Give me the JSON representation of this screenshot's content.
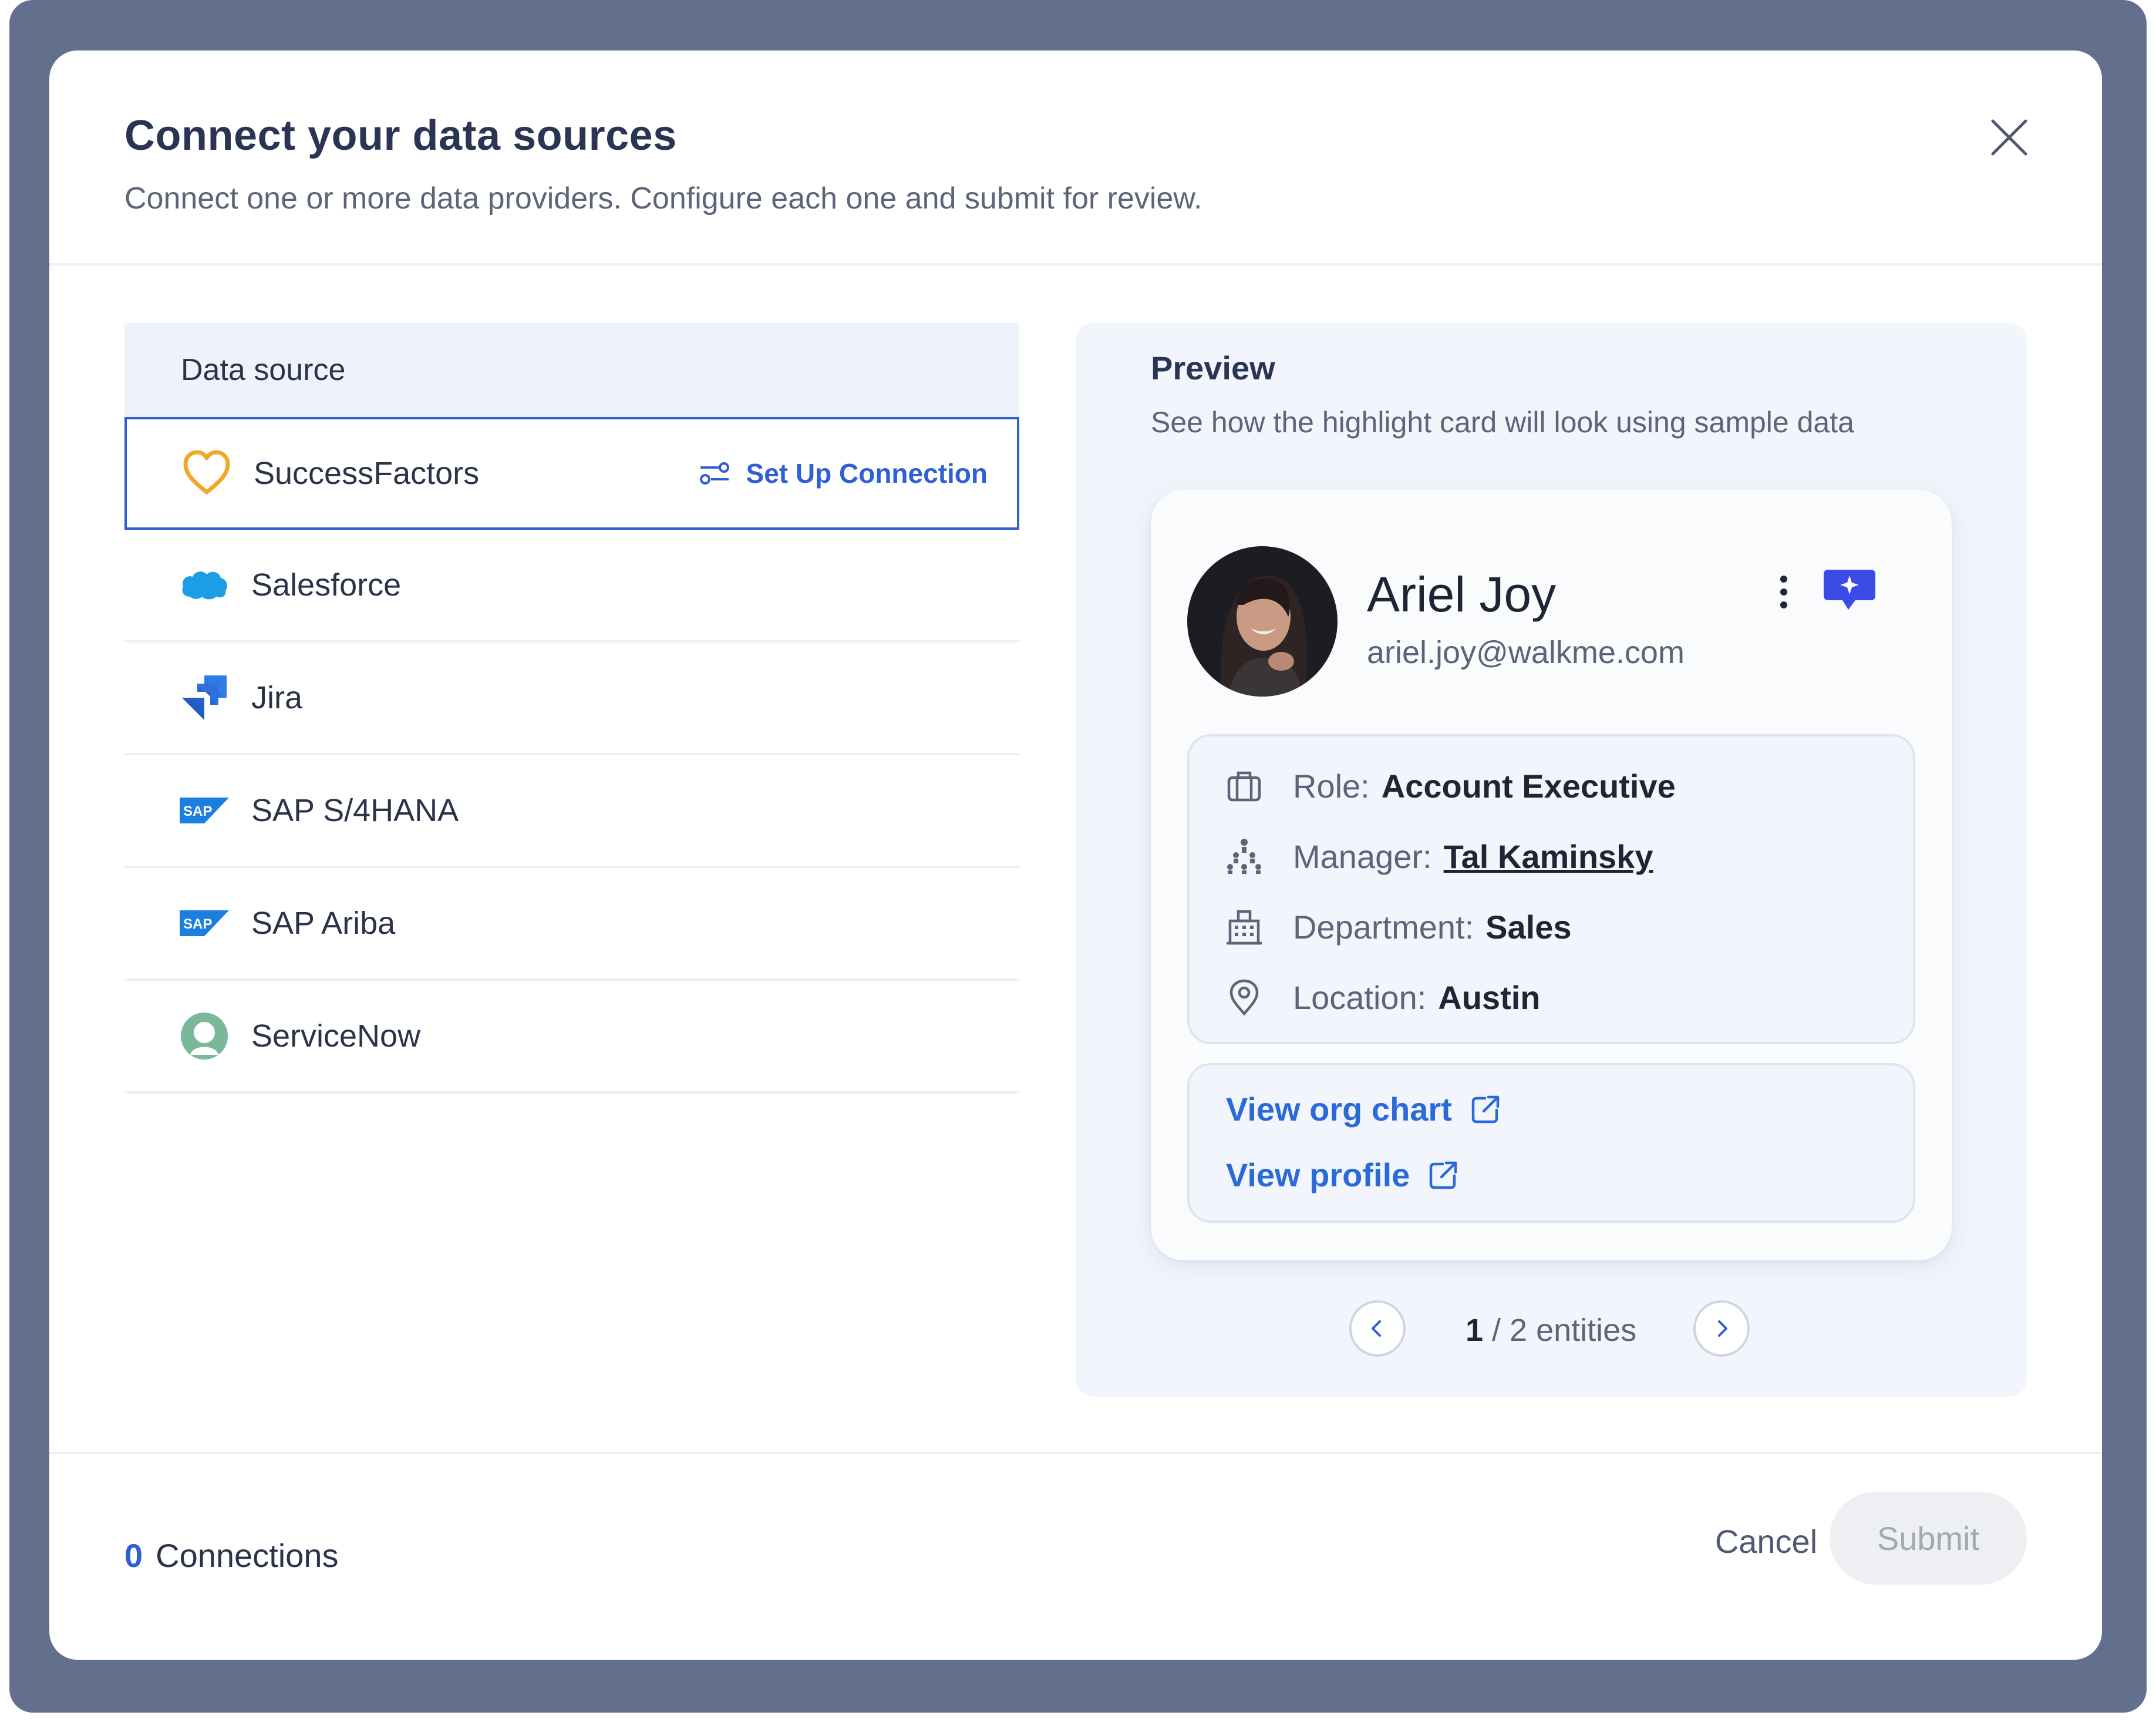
{
  "dialog": {
    "title": "Connect your data sources",
    "subtitle": "Connect one or more data providers. Configure each one and submit for review."
  },
  "data_sources": {
    "header": "Data source",
    "setup_label": "Set Up Connection",
    "items": [
      {
        "label": "SuccessFactors",
        "icon": "heart-icon",
        "selected": true
      },
      {
        "label": "Salesforce",
        "icon": "salesforce-cloud-icon"
      },
      {
        "label": "Jira",
        "icon": "jira-icon"
      },
      {
        "label": "SAP S/4HANA",
        "icon": "sap-logo-icon"
      },
      {
        "label": "SAP Ariba",
        "icon": "sap-logo-icon"
      },
      {
        "label": "ServiceNow",
        "icon": "servicenow-icon"
      }
    ]
  },
  "preview": {
    "title": "Preview",
    "subtitle": "See how the highlight card will look using sample data",
    "card": {
      "name": "Ariel Joy",
      "email": "ariel.joy@walkme.com",
      "fields": [
        {
          "key": "Role:",
          "value": "Account Executive",
          "icon": "briefcase-icon"
        },
        {
          "key": "Manager:",
          "value": "Tal Kaminsky",
          "icon": "org-chart-icon"
        },
        {
          "key": "Department:",
          "value": "Sales",
          "icon": "building-icon"
        },
        {
          "key": "Location:",
          "value": "Austin",
          "icon": "location-pin-icon"
        }
      ],
      "links": [
        {
          "label": "View org chart",
          "icon": "external-link-icon"
        },
        {
          "label": "View profile",
          "icon": "external-link-icon"
        }
      ]
    },
    "pager": {
      "current": "1",
      "rest": " / 2 entities"
    }
  },
  "footer": {
    "connections_count": "0",
    "connections_label": "Connections",
    "cancel_label": "Cancel",
    "submit_label": "Submit"
  },
  "colors": {
    "accent": "#2f5fd4",
    "link": "#2a6ad8",
    "backdrop": "#626f8d",
    "panel_bg": "#f2f5fb"
  }
}
